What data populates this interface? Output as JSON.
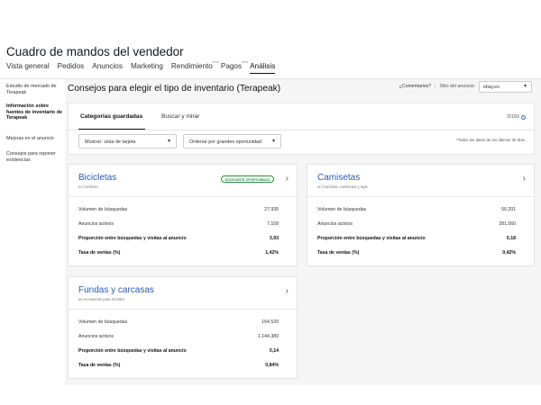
{
  "header": {
    "title": "Cuadro de mandos del vendedor",
    "nav": [
      {
        "label": "Vista general",
        "sup": ""
      },
      {
        "label": "Pedidos",
        "sup": ""
      },
      {
        "label": "Anuncios",
        "sup": ""
      },
      {
        "label": "Marketing",
        "sup": ""
      },
      {
        "label": "Rendimiento",
        "sup": "beta"
      },
      {
        "label": "Pagos",
        "sup": "beta"
      },
      {
        "label": "Análisis",
        "sup": ""
      }
    ],
    "active_tab": "Análisis"
  },
  "sidebar": {
    "items": [
      {
        "label": "Estudio de mercado de Terapeak",
        "active": false
      },
      {
        "label": "Información sobre fuentes de inventario de Terapeak",
        "active": true
      },
      {
        "label": "Mejoras en el anuncio",
        "active": false
      },
      {
        "label": "Consejos para reponer existencias",
        "active": false
      }
    ]
  },
  "main": {
    "title": "Consejos para elegir el tipo de inventario (Terapeak)",
    "comments_link": "¿Comentarios?",
    "separator": "|",
    "site_label": "Sitio del anuncio:",
    "site_value": "ebay.es"
  },
  "filters": {
    "tabs": [
      "Categorías guardadas",
      "Buscar y mirar"
    ],
    "active_tab": "Categorías guardadas",
    "counter": "0/150",
    "show_dropdown": "Mostrar: vista de tarjeta",
    "sort_dropdown": "Ordenar por grandes oportunidad",
    "note": "*Todos los datos de los últimos 30 días"
  },
  "cards": [
    {
      "title": "Bicicletas",
      "subtitle": "en Ciclismo",
      "badge": "EXCELENTE OPORTUNIDAD",
      "rows": [
        {
          "label": "Volumen de búsquedas",
          "value": "27.935",
          "bold": false
        },
        {
          "label": "Anuncios activos",
          "value": "7.109",
          "bold": false
        },
        {
          "label": "Proporción entre búsquedas y visitas al anuncio",
          "value": "3,93",
          "bold": true
        },
        {
          "label": "Tasa de ventas (%)",
          "value": "1,42%",
          "bold": true
        }
      ]
    },
    {
      "title": "Camisetas",
      "subtitle": "en Camisas, camisetas y tops",
      "badge": "",
      "rows": [
        {
          "label": "Volumen de búsquedas",
          "value": "50.201",
          "bold": false
        },
        {
          "label": "Anuncios activos",
          "value": "281.060",
          "bold": false
        },
        {
          "label": "Proporción entre búsquedas y visitas al anuncio",
          "value": "0,18",
          "bold": true
        },
        {
          "label": "Tasa de ventas (%)",
          "value": "0,42%",
          "bold": true
        }
      ]
    },
    {
      "title": "Fundas y carcasas",
      "subtitle": "en Accesorios para móviles",
      "badge": "",
      "rows": [
        {
          "label": "Volumen de búsquedas",
          "value": "164.520",
          "bold": false
        },
        {
          "label": "Anuncios activos",
          "value": "1.144.389",
          "bold": false
        },
        {
          "label": "Proporción entre búsquedas y visitas al anuncio",
          "value": "0,14",
          "bold": true
        },
        {
          "label": "Tasa de ventas (%)",
          "value": "0,84%",
          "bold": true
        }
      ]
    }
  ],
  "colors": {
    "link": "#2a5ab0",
    "badge": "#2e8b3f",
    "background": "#f5f5f5"
  }
}
